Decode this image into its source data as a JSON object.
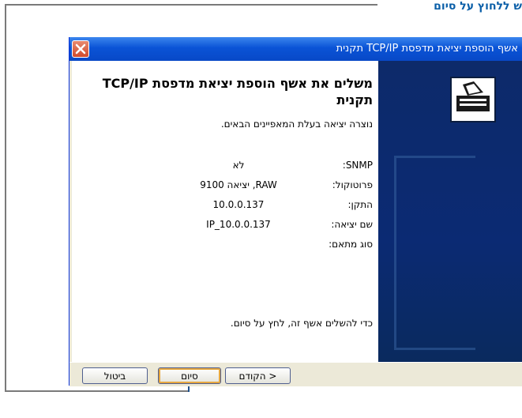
{
  "callout": {
    "text": "ש ללחוץ על סיום"
  },
  "window": {
    "title": "אשף הוספת יציאת מדפסת TCP/IP תקנית",
    "header_title": "משלים את אשף הוספת יציאת מדפסת TCP/IP תקנית",
    "subtitle": "נוצרה יציאה בעלת המאפיינים הבאים.",
    "properties": [
      {
        "label": "SNMP:",
        "value": "לא"
      },
      {
        "label": "פרוטוקול:",
        "value": "RAW, יציאה 9100"
      },
      {
        "label": "התקן:",
        "value": "10.0.0.137"
      },
      {
        "label": "שם יציאה:",
        "value": "IP_10.0.0.137"
      },
      {
        "label": "סוג מתאם:",
        "value": ""
      }
    ],
    "footer_hint": "כדי להשלים אשף זה, לחץ על סיום.",
    "buttons": {
      "back": "< הקודם",
      "finish": "סיום",
      "cancel": "ביטול"
    }
  },
  "colors": {
    "callout": "#0b5fa8",
    "titlebar": "#0a53d6",
    "side_panel": "#0b2a73",
    "arrow": "#1c4f8c"
  }
}
